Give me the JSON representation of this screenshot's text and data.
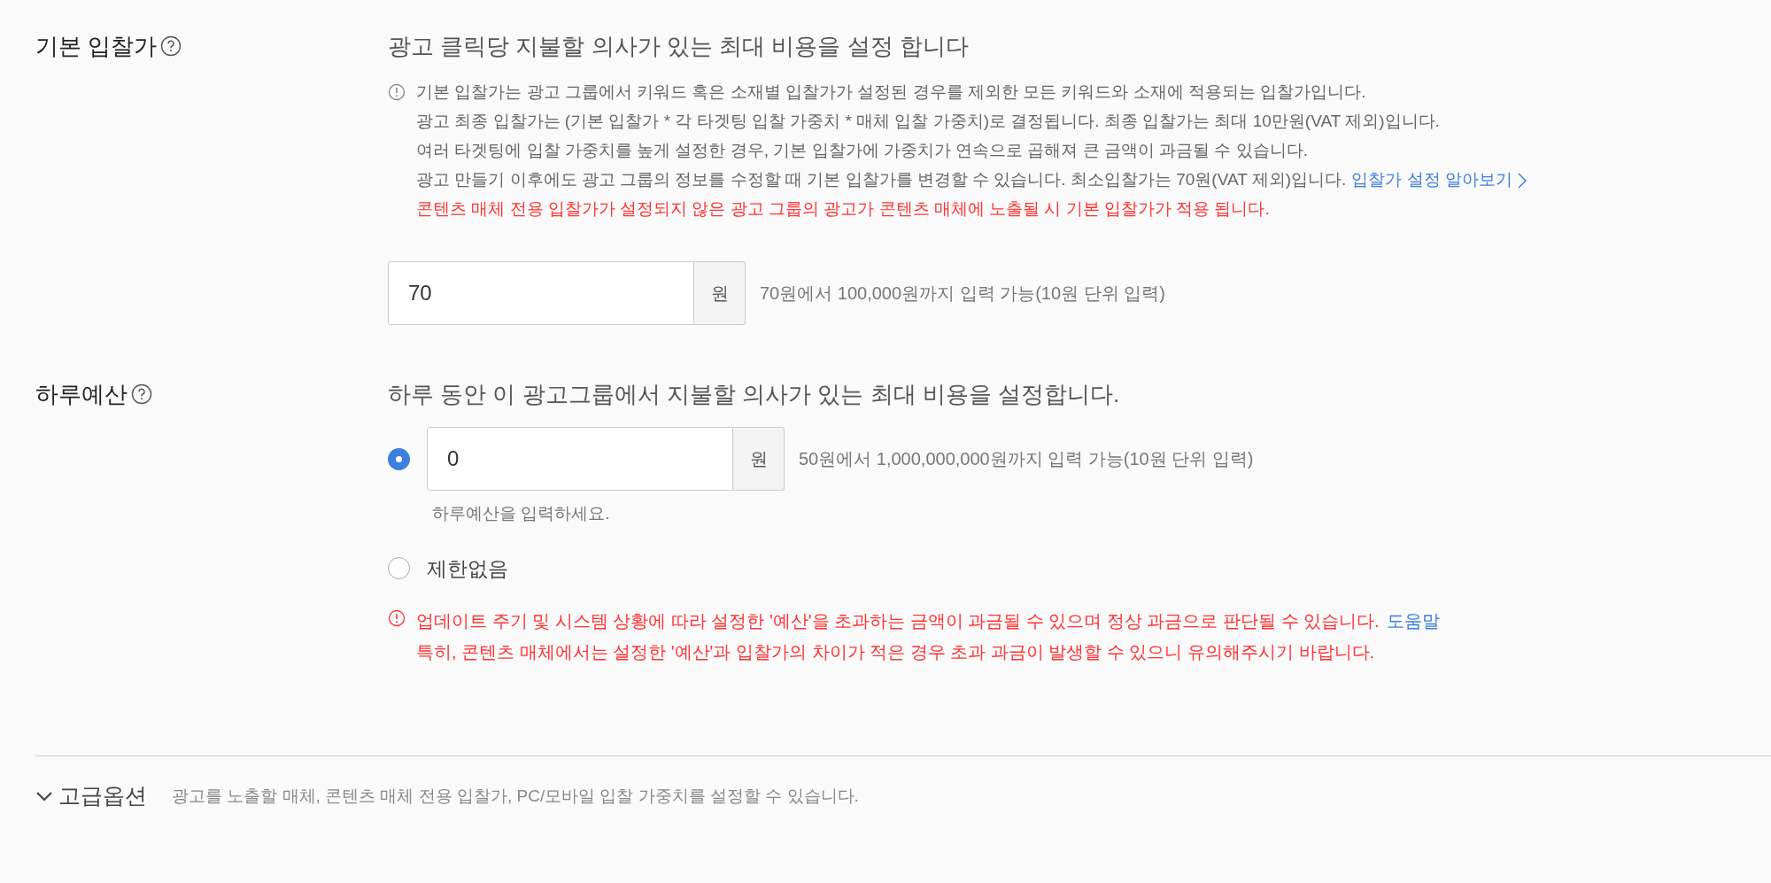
{
  "bid": {
    "label": "기본 입찰가",
    "heading": "광고 클릭당 지불할 의사가 있는 최대 비용을 설정 합니다",
    "notes": [
      {
        "text": "기본 입찰가는 광고 그룹에서 키워드 혹은 소재별 입찰가가 설정된 경우를 제외한 모든 키워드와 소재에 적용되는 입찰가입니다.",
        "color": "#666666"
      },
      {
        "text": "광고 최종 입찰가는 (기본 입찰가 * 각 타겟팅 입찰 가중치 * 매체 입찰 가중치)로 결정됩니다. 최종 입찰가는 최대 10만원(VAT 제외)입니다.",
        "color": "#666666"
      },
      {
        "text": "여러 타겟팅에 입찰 가중치를 높게 설정한 경우, 기본 입찰가에 가중치가 연속으로 곱해져 큰 금액이 과금될 수 있습니다.",
        "color": "#666666"
      },
      {
        "text": "광고 만들기 이후에도 광고 그룹의 정보를 수정할 때 기본 입찰가를 변경할 수 있습니다. 최소입찰가는 70원(VAT 제외)입니다.",
        "color": "#666666",
        "link": "입찰가 설정 알아보기"
      },
      {
        "text": "콘텐츠 매체 전용 입찰가가 설정되지 않은 광고 그룹의 광고가 콘텐츠 매체에 노출될 시 기본 입찰가가 적용 됩니다.",
        "color": "#ff3333"
      }
    ],
    "field": {
      "value": "70",
      "unit": "원",
      "range": "70원에서 100,000원까지 입력 가능(10원 단위 입력)"
    }
  },
  "budget": {
    "label": "하루예산",
    "heading": "하루 동안 이 광고그룹에서 지불할 의사가 있는 최대 비용을 설정합니다.",
    "options": [
      {
        "kind": "input",
        "selected": true,
        "value": "0",
        "unit": "원",
        "range": "50원에서 1,000,000,000원까지 입력 가능(10원 단위 입력)",
        "hint": "하루예산을 입력하세요."
      },
      {
        "kind": "plain",
        "selected": false,
        "label": "제한없음"
      }
    ],
    "warning": [
      {
        "text": "업데이트 주기 및 시스템 상황에 따라 설정한 '예산'을 초과하는 금액이 과금될 수 있으며 정상 과금으로 판단될 수 있습니다.",
        "link": "도움말"
      },
      {
        "text": "특히, 콘텐츠 매체에서는 설정한 '예산'과 입찰가의 차이가 적은 경우 초과 과금이 발생할 수 있으니 유의해주시기 바랍니다."
      }
    ]
  },
  "advanced": {
    "title": "고급옵션",
    "expanded": false,
    "description": "광고를 노출할 매체, 콘텐츠 매체 전용 입찰가, PC/모바일 입찰 가중치를 설정할 수 있습니다."
  }
}
